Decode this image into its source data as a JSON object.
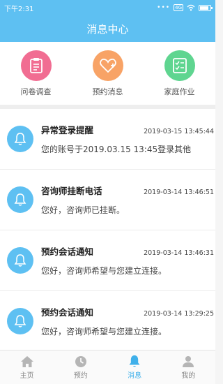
{
  "status_bar": {
    "time": "下午2:31",
    "signal_dots": "•••",
    "badge": "4G"
  },
  "header": {
    "title": "消息中心"
  },
  "quick_actions": [
    {
      "label": "问卷调查",
      "icon": "clipboard-icon",
      "color": "#f16d92"
    },
    {
      "label": "预约消息",
      "icon": "heart-plus-icon",
      "color": "#f8a366"
    },
    {
      "label": "家庭作业",
      "icon": "checklist-icon",
      "color": "#5fd590"
    }
  ],
  "messages": [
    {
      "title": "异常登录提醒",
      "time": "2019-03-15 13:45:44",
      "text": "您的账号于2019.03.15 13:45登录其他"
    },
    {
      "title": "咨询师挂断电话",
      "time": "2019-03-14 13:46:51",
      "text": "您好，咨询师已挂断。"
    },
    {
      "title": "预约会话通知",
      "time": "2019-03-14 13:46:31",
      "text": "您好，咨询师希望与您建立连接。"
    },
    {
      "title": "预约会话通知",
      "time": "2019-03-14 13:29:25",
      "text": "您好，咨询师希望与您建立连接。"
    }
  ],
  "tabs": [
    {
      "label": "主页",
      "icon": "home-icon"
    },
    {
      "label": "预约",
      "icon": "clock-icon"
    },
    {
      "label": "消息",
      "icon": "bell-icon",
      "active": true
    },
    {
      "label": "我的",
      "icon": "user-icon"
    }
  ],
  "colors": {
    "primary": "#5ec0f2",
    "active_tab": "#3fb0ea"
  }
}
